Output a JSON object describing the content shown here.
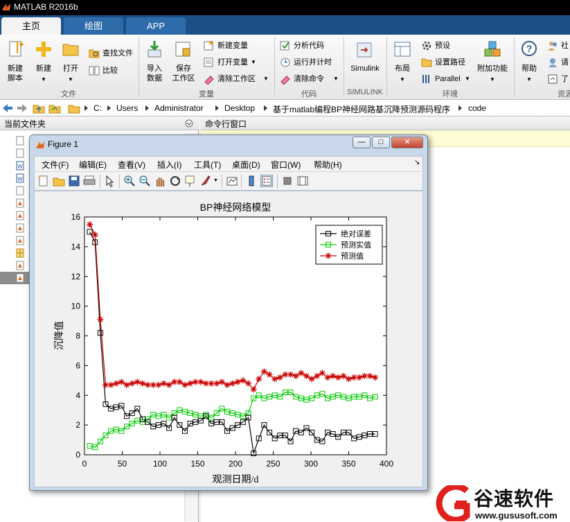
{
  "app": {
    "title": "MATLAB R2016b"
  },
  "tabs": [
    {
      "label": "主页"
    },
    {
      "label": "绘图"
    },
    {
      "label": "APP"
    }
  ],
  "ribbon": {
    "file": {
      "new_script": "新建\n脚本",
      "new": "新建",
      "open": "打开",
      "find_files": "查找文件",
      "compare": "比较",
      "group": "文件"
    },
    "variable": {
      "import": "导入\n数据",
      "save_ws": "保存\n工作区",
      "new_var": "新建变量",
      "open_var": "打开变量",
      "clear_ws": "清除工作区",
      "group": "变量"
    },
    "code": {
      "analyze": "分析代码",
      "run_time": "运行并计时",
      "clear_cmd": "清除命令",
      "group": "代码"
    },
    "simulink": {
      "label": "Simulink",
      "group": "SIMULINK"
    },
    "env": {
      "layout": "布局",
      "prefs": "预设",
      "set_path": "设置路径",
      "parallel": "Parallel",
      "addons": "附加功能",
      "group": "环境"
    },
    "resources": {
      "help": "帮助",
      "community": "社",
      "request": "请",
      "learn": "了",
      "group": "资源"
    }
  },
  "address": {
    "segments": [
      "C:",
      "Users",
      "Administrator",
      "Desktop",
      "基于matlab编程BP神经网路基沉降预测源码程序",
      "code"
    ]
  },
  "left_panel": {
    "title": "当前文件夹"
  },
  "command_window": {
    "title": "命令行窗口"
  },
  "figure": {
    "title": "Figure 1",
    "controls": {
      "minimize": "—",
      "maximize": "□",
      "close": "✕"
    },
    "menu": [
      "文件(F)",
      "编辑(E)",
      "查看(V)",
      "插入(I)",
      "工具(T)",
      "桌面(D)",
      "窗口(W)",
      "帮助(H)"
    ],
    "menu_arrow": "↘"
  },
  "chart_data": {
    "type": "line",
    "title": "BP神经网络模型",
    "xlabel": "观测日期/d",
    "ylabel": "沉降值",
    "xlim": [
      0,
      400
    ],
    "ylim": [
      0,
      16
    ],
    "xticks": [
      0,
      50,
      100,
      150,
      200,
      250,
      300,
      350,
      400
    ],
    "yticks": [
      0,
      2,
      4,
      6,
      8,
      10,
      12,
      14,
      16
    ],
    "legend_position": "top-right",
    "grid": false,
    "series": [
      {
        "name": "绝对误差",
        "color": "#000000",
        "marker": "square",
        "x": [
          7,
          14,
          21,
          28,
          35,
          42,
          49,
          56,
          63,
          70,
          77,
          84,
          91,
          98,
          105,
          112,
          119,
          126,
          133,
          140,
          147,
          154,
          161,
          168,
          175,
          182,
          189,
          196,
          203,
          210,
          217,
          224,
          231,
          238,
          245,
          252,
          259,
          266,
          273,
          280,
          287,
          294,
          301,
          308,
          315,
          322,
          329,
          336,
          343,
          350,
          357,
          364,
          371,
          378,
          385
        ],
        "y": [
          15.0,
          14.3,
          8.2,
          3.4,
          3.1,
          3.2,
          3.3,
          2.6,
          2.8,
          3.1,
          2.4,
          2.2,
          1.9,
          2.0,
          2.1,
          1.8,
          2.5,
          2.0,
          1.6,
          2.1,
          2.2,
          2.3,
          2.6,
          2.1,
          2.2,
          2.2,
          1.6,
          1.8,
          2.0,
          2.2,
          2.5,
          0.1,
          1.1,
          2.0,
          1.5,
          1.1,
          1.3,
          1.3,
          0.9,
          1.6,
          1.5,
          1.8,
          1.5,
          1.0,
          0.9,
          1.5,
          1.4,
          1.2,
          1.5,
          1.5,
          1.1,
          1.2,
          1.3,
          1.4,
          1.4
        ]
      },
      {
        "name": "预测实值",
        "color": "#00cc00",
        "marker": "square",
        "x": [
          7,
          14,
          21,
          28,
          35,
          42,
          49,
          56,
          63,
          70,
          77,
          84,
          91,
          98,
          105,
          112,
          119,
          126,
          133,
          140,
          147,
          154,
          161,
          168,
          175,
          182,
          189,
          196,
          203,
          210,
          217,
          224,
          231,
          238,
          245,
          252,
          259,
          266,
          273,
          280,
          287,
          294,
          301,
          308,
          315,
          322,
          329,
          336,
          343,
          350,
          357,
          364,
          371,
          378,
          385
        ],
        "y": [
          0.6,
          0.5,
          0.9,
          1.3,
          1.6,
          1.7,
          1.6,
          1.9,
          2.1,
          2.3,
          2.2,
          2.4,
          2.7,
          2.6,
          2.7,
          2.5,
          2.8,
          3.0,
          2.9,
          2.8,
          2.7,
          2.6,
          2.7,
          2.5,
          2.8,
          3.1,
          2.9,
          2.8,
          2.7,
          2.6,
          2.8,
          3.8,
          4.0,
          3.8,
          3.9,
          4.0,
          3.9,
          4.2,
          4.2,
          3.9,
          3.8,
          3.7,
          3.8,
          4.0,
          4.1,
          3.8,
          3.9,
          4.0,
          3.9,
          3.8,
          3.9,
          3.9,
          4.0,
          3.8,
          3.9
        ]
      },
      {
        "name": "预测值",
        "color": "#cc0000",
        "marker": "star",
        "x": [
          7,
          14,
          21,
          28,
          35,
          42,
          49,
          56,
          63,
          70,
          77,
          84,
          91,
          98,
          105,
          112,
          119,
          126,
          133,
          140,
          147,
          154,
          161,
          168,
          175,
          182,
          189,
          196,
          203,
          210,
          217,
          224,
          231,
          238,
          245,
          252,
          259,
          266,
          273,
          280,
          287,
          294,
          301,
          308,
          315,
          322,
          329,
          336,
          343,
          350,
          357,
          364,
          371,
          378,
          385
        ],
        "y": [
          15.5,
          14.8,
          9.1,
          4.7,
          4.7,
          4.8,
          4.9,
          4.7,
          4.8,
          4.9,
          4.8,
          4.7,
          4.7,
          4.7,
          4.8,
          4.7,
          4.9,
          4.9,
          4.7,
          4.8,
          4.9,
          4.9,
          4.8,
          4.8,
          4.8,
          4.9,
          4.7,
          4.8,
          4.9,
          5.0,
          4.8,
          4.4,
          5.1,
          5.6,
          5.4,
          5.1,
          5.2,
          5.4,
          5.4,
          5.3,
          5.5,
          5.3,
          5.1,
          5.3,
          5.5,
          5.2,
          5.3,
          5.2,
          5.3,
          5.1,
          5.2,
          5.2,
          5.3,
          5.3,
          5.2
        ]
      }
    ]
  },
  "watermark": {
    "brand": "谷速软件",
    "url": "www.gususoft.com"
  }
}
